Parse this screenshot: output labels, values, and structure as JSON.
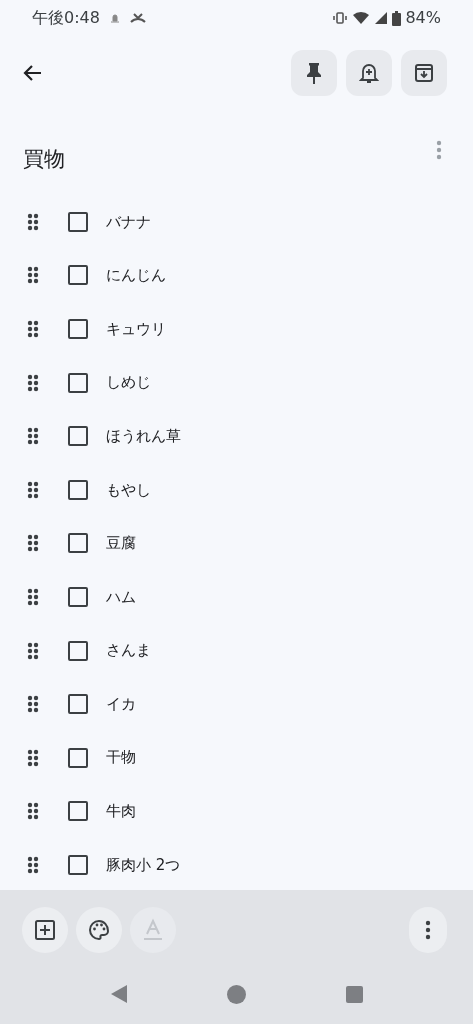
{
  "status_bar": {
    "time": "午後0:48",
    "battery": "84%"
  },
  "note": {
    "title": "買物",
    "items": [
      {
        "text": "バナナ",
        "checked": false
      },
      {
        "text": "にんじん",
        "checked": false
      },
      {
        "text": "キュウリ",
        "checked": false
      },
      {
        "text": "しめじ",
        "checked": false
      },
      {
        "text": "ほうれん草",
        "checked": false
      },
      {
        "text": "もやし",
        "checked": false
      },
      {
        "text": "豆腐",
        "checked": false
      },
      {
        "text": "ハム",
        "checked": false
      },
      {
        "text": "さんま",
        "checked": false
      },
      {
        "text": "イカ",
        "checked": false
      },
      {
        "text": "干物",
        "checked": false
      },
      {
        "text": "牛肉",
        "checked": false
      },
      {
        "text": "豚肉小 2つ",
        "checked": false
      }
    ]
  },
  "bottom_toolbar": [
    {
      "kind": "add",
      "disabled": false
    },
    {
      "kind": "palette",
      "disabled": false
    },
    {
      "kind": "text_format",
      "disabled": true
    }
  ]
}
